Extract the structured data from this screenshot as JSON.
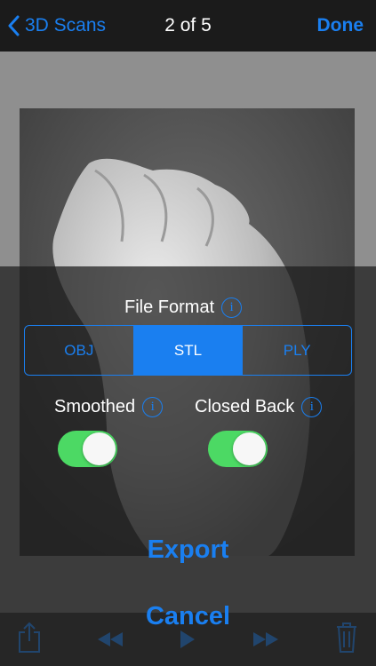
{
  "nav": {
    "back_label": "3D Scans",
    "title": "2 of 5",
    "done_label": "Done"
  },
  "export_panel": {
    "file_format_label": "File Format",
    "formats": [
      "OBJ",
      "STL",
      "PLY"
    ],
    "selected_format": "STL",
    "smoothed_label": "Smoothed",
    "smoothed_on": true,
    "closed_back_label": "Closed Back",
    "closed_back_on": true,
    "export_label": "Export",
    "cancel_label": "Cancel"
  },
  "toolbar": {
    "icons": [
      "share-icon",
      "rewind-icon",
      "play-icon",
      "fast-forward-icon",
      "trash-icon"
    ]
  },
  "colors": {
    "accent": "#1a7ff0",
    "toggle_on": "#4cd964",
    "nav_bg": "#1b1b1b",
    "viewer_bg": "#8f8f8f"
  }
}
